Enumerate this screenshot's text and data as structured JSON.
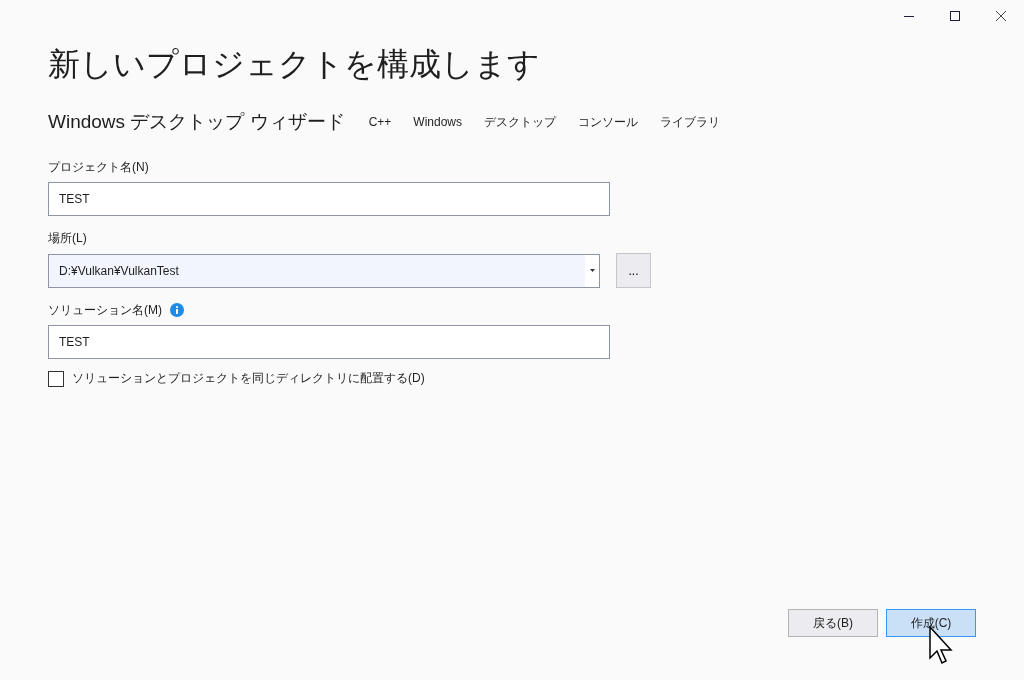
{
  "window": {
    "title": "新しいプロジェクトを構成します"
  },
  "template": {
    "name": "Windows デスクトップ ウィザード",
    "tags": [
      "C++",
      "Windows",
      "デスクトップ",
      "コンソール",
      "ライブラリ"
    ]
  },
  "fields": [
    {
      "kind": "text",
      "label": "プロジェクト名(N)",
      "value": "TEST"
    },
    {
      "kind": "combo",
      "label": "場所(L)",
      "value": "D:¥Vulkan¥VulkanTest",
      "browse": "..."
    },
    {
      "kind": "text",
      "label": "ソリューション名(M)",
      "info": true,
      "value": "TEST"
    }
  ],
  "option": {
    "label": "ソリューションとプロジェクトを同じディレクトリに配置する(D)",
    "checked": false
  },
  "buttons": [
    {
      "label": "戻る(B)",
      "highlighted": false
    },
    {
      "label": "作成(C)",
      "highlighted": true
    }
  ]
}
